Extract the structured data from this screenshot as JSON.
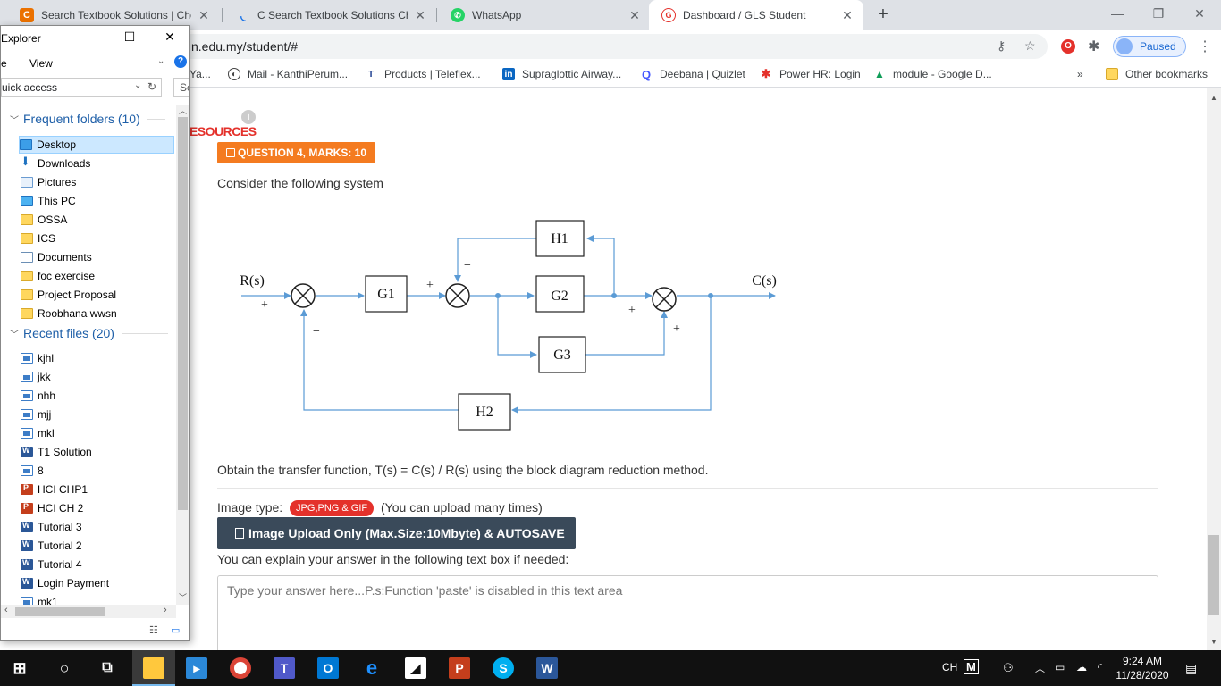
{
  "browser": {
    "tabs": [
      {
        "title": "Search Textbook Solutions | Cheg",
        "icon": "chegg-icon",
        "active": false
      },
      {
        "title": "C Search Textbook Solutions Che",
        "icon": "loading-icon",
        "active": false
      },
      {
        "title": "WhatsApp",
        "icon": "whatsapp-icon",
        "active": false
      },
      {
        "title": "Dashboard / GLS Student",
        "icon": "gls-icon",
        "active": true
      }
    ],
    "url": "n.edu.my/student/#",
    "profile_status": "Paused",
    "bookmarks": [
      {
        "label": "Ya...",
        "icon": "page-icon"
      },
      {
        "label": "Mail - KanthiPerum...",
        "icon": "mail-icon"
      },
      {
        "label": "Products | Teleflex...",
        "icon": "teleflex-icon"
      },
      {
        "label": "Supraglottic Airway...",
        "icon": "linkedin-icon"
      },
      {
        "label": "Deebana | Quizlet",
        "icon": "quizlet-icon"
      },
      {
        "label": "Power HR: Login",
        "icon": "powerhr-icon"
      },
      {
        "label": "module - Google D...",
        "icon": "google-drive-icon"
      },
      {
        "label": "»",
        "icon": "overflow-icon"
      },
      {
        "label": "Other bookmarks",
        "icon": "folder-icon"
      }
    ]
  },
  "page": {
    "section_label": "ESOURCES",
    "question_badge": "QUESTION 4, MARKS: 10",
    "intro": "Consider the following system",
    "instruction": "Obtain the transfer function, T(s) = C(s) / R(s) using the block diagram reduction method.",
    "image_type_label": "Image type:",
    "image_type_value": "JPG,PNG & GIF",
    "image_type_note": "(You can upload many times)",
    "upload_button": "Image Upload Only (Max.Size:10Mbyte) & AUTOSAVE",
    "explain_label": "You can explain your answer in the following text box if needed:",
    "answer_placeholder": "Type your answer here...P.s:Function 'paste' is disabled in this text area"
  },
  "diagram": {
    "input_label": "R(s)",
    "output_label": "C(s)",
    "blocks": [
      "G1",
      "G2",
      "G3",
      "H1",
      "H2"
    ],
    "signs": {
      "s1_in": "+",
      "s1_fb": "−",
      "s2_in": "+",
      "s2_fb": "−",
      "s3_in": "+",
      "s3_g3": "+"
    }
  },
  "explorer": {
    "title": "Explorer",
    "ribbon": [
      "e",
      "View"
    ],
    "address": "uick access",
    "search_placeholder": "Se",
    "frequent_header": "Frequent folders (10)",
    "frequent": [
      {
        "label": "Desktop",
        "type": "desktop"
      },
      {
        "label": "Downloads",
        "type": "download"
      },
      {
        "label": "Pictures",
        "type": "pictures"
      },
      {
        "label": "This PC",
        "type": "pc"
      },
      {
        "label": "OSSA",
        "type": "folder"
      },
      {
        "label": "ICS",
        "type": "folder"
      },
      {
        "label": "Documents",
        "type": "doc"
      },
      {
        "label": "foc exercise",
        "type": "folder"
      },
      {
        "label": "Project Proposal",
        "type": "folder"
      },
      {
        "label": "Roobhana wwsn",
        "type": "folder"
      }
    ],
    "recent_header": "Recent files (20)",
    "recent": [
      {
        "label": "kjhl",
        "type": "img"
      },
      {
        "label": "jkk",
        "type": "img"
      },
      {
        "label": "nhh",
        "type": "img"
      },
      {
        "label": "mjj",
        "type": "img"
      },
      {
        "label": "mkl",
        "type": "img"
      },
      {
        "label": "T1 Solution",
        "type": "word"
      },
      {
        "label": "8",
        "type": "img"
      },
      {
        "label": "HCI CHP1",
        "type": "ppt"
      },
      {
        "label": "HCI CH 2",
        "type": "ppt"
      },
      {
        "label": "Tutorial 3",
        "type": "word"
      },
      {
        "label": "Tutorial 2",
        "type": "word"
      },
      {
        "label": "Tutorial 4",
        "type": "word"
      },
      {
        "label": "Login Payment",
        "type": "word"
      },
      {
        "label": "mk1",
        "type": "img"
      }
    ]
  },
  "taskbar": {
    "language": "CH",
    "ime": "M",
    "time": "9:24 AM",
    "date": "11/28/2020"
  }
}
